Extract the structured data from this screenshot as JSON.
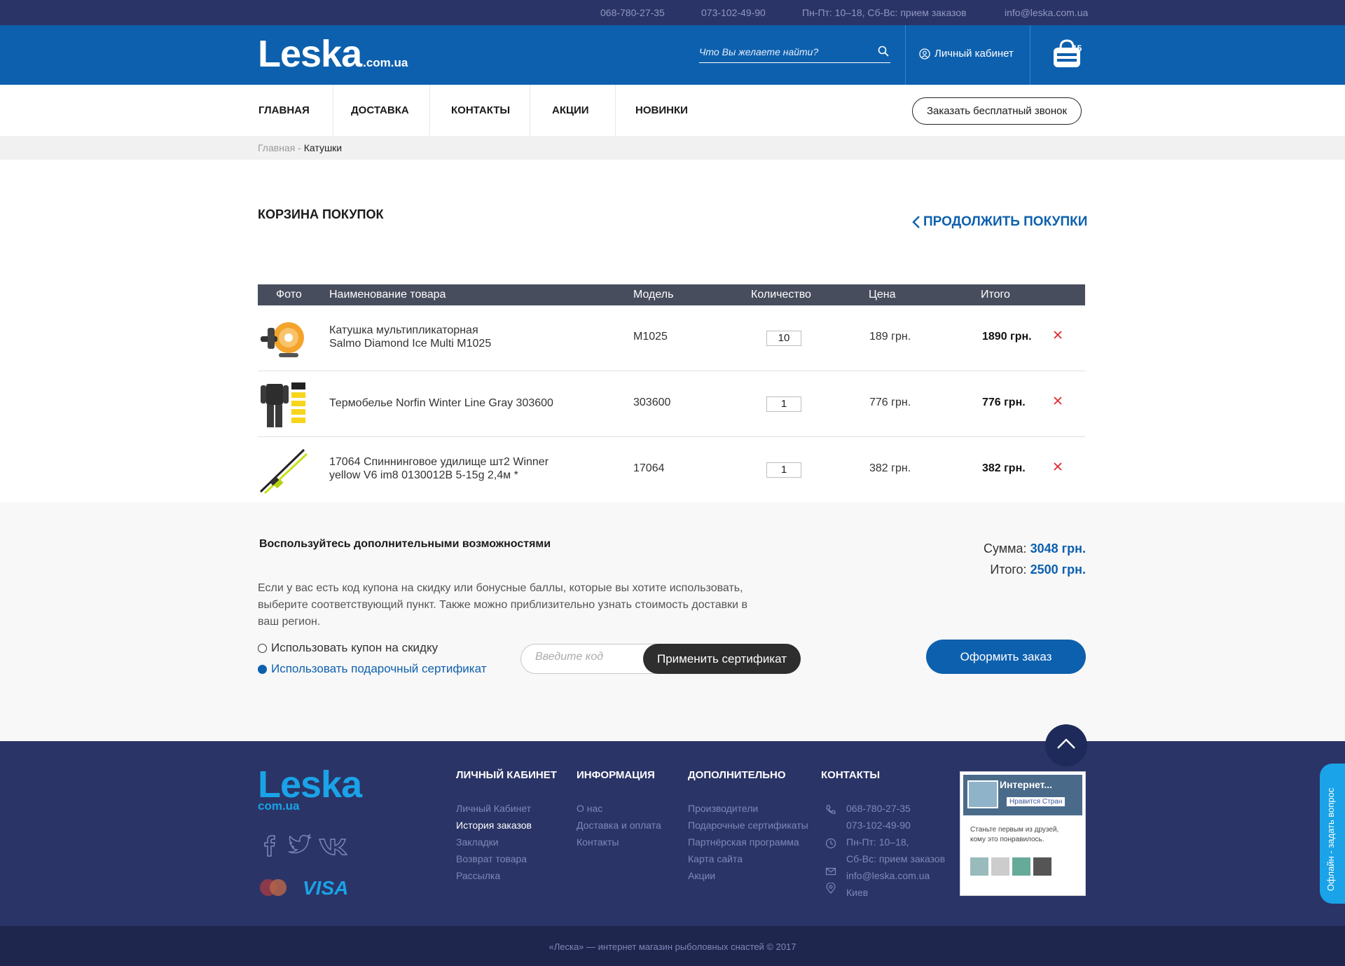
{
  "topbar": {
    "phone1": "068-780-27-35",
    "phone2": "073-102-49-90",
    "hours": "Пн-Пт: 10–18, Сб-Вс: прием заказов",
    "email": "info@leska.com.ua"
  },
  "header": {
    "logo_main": "Leska",
    "logo_domain": ".com.ua",
    "search_placeholder": "Что Вы желаете найти?",
    "cabinet_label": "Личный кабинет",
    "cart_count": "15"
  },
  "nav": {
    "items": [
      "ГЛАВНАЯ",
      "ДОСТАВКА",
      "КОНТАКТЫ",
      "АКЦИИ",
      "НОВИНКИ"
    ],
    "callback_label": "Заказать бесплатный звонок"
  },
  "breadcrumb": {
    "home": "Главная",
    "separator": " - ",
    "current": "Катушки"
  },
  "cart": {
    "title": "КОРЗИНА ПОКУПОК",
    "continue_label": "ПРОДОЛЖИТЬ ПОКУПКИ",
    "columns": [
      "Фото",
      "Наименование товара",
      "Модель",
      "Количество",
      "Цена",
      "Итого"
    ],
    "items": [
      {
        "name_line1": "Катушка мультипликаторная",
        "name_line2": "Salmo Diamond Ice Multi M1025",
        "model": "M1025",
        "qty": "10",
        "price": "189 грн.",
        "total": "1890 грн.",
        "image_icon": "fishing-reel-image"
      },
      {
        "name_line1": "Термобелье Norfin Winter Line Gray 303600",
        "name_line2": "",
        "model": "303600",
        "qty": "1",
        "price": "776 грн.",
        "total": "776 грн.",
        "image_icon": "thermal-underwear-image"
      },
      {
        "name_line1": "17064 Спиннинговое удилище шт2 Winner",
        "name_line2": "yellow V6 im8 0130012B 5-15g 2,4м *",
        "model": "17064",
        "qty": "1",
        "price": "382 грн.",
        "total": "382 грн.",
        "image_icon": "spinning-rod-image"
      }
    ]
  },
  "extra": {
    "title": "Воспользуйтесь дополнительными возможностями",
    "text": "Если у вас есть код купона на скидку или бонусные баллы, которые вы хотите использовать, выберите соответствующий пункт. Также можно приблизительно узнать стоимость доставки в ваш регион.",
    "option_coupon": "Использовать купон на скидку",
    "option_cert": "Использовать подарочный сертификат",
    "code_placeholder": "Введите код",
    "apply_label": "Применить сертификат",
    "sum_label": "Сумма:",
    "sum_value": "3048 грн.",
    "total_label": "Итого:",
    "total_value": "2500 грн.",
    "order_label": "Оформить заказ"
  },
  "footer": {
    "logo_main": "Leska",
    "logo_domain": "com.ua",
    "col_cabinet": {
      "title": "ЛИЧНЫЙ КАБИНЕТ",
      "links": [
        "Личный Кабинет",
        "История заказов",
        "Закладки",
        "Возврат товара",
        "Рассылка"
      ]
    },
    "col_info": {
      "title": "ИНФОРМАЦИЯ",
      "links": [
        "О нас",
        "Доставка и оплата",
        "Контакты"
      ]
    },
    "col_extra": {
      "title": "ДОПОЛНИТЕЛЬНО",
      "links": [
        "Производители",
        "Подарочные сертификаты",
        "Партнёрская программа",
        "Карта сайта",
        "Акции"
      ]
    },
    "col_contacts": {
      "title": "КОНТАКТЫ",
      "phone1": "068-780-27-35",
      "phone2": "073-102-49-90",
      "hours1": "Пн-Пт: 10–18,",
      "hours2": "Сб-Вс: прием заказов",
      "email": "info@leska.com.ua",
      "city": "Киев"
    },
    "fb": {
      "title": "Интернет...",
      "like": "Нравится Стран",
      "text": "Станьте первым из друзей, кому это понравилось."
    },
    "copyright": "«Леска» — интернет магазин рыболовных снастей © 2017",
    "side_tab": "Офлайн - задать вопрос"
  },
  "colors": {
    "brand_blue": "#0d60ae",
    "top_navy": "#2b3466",
    "footer_accent": "#1aa3e8",
    "delete_red": "#e0282e"
  }
}
